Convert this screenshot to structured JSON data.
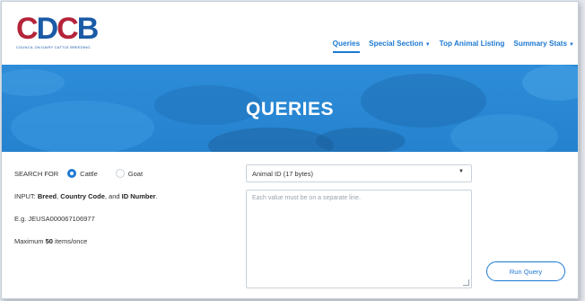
{
  "logo": {
    "mark_c1": "C",
    "mark_d": "D",
    "mark_c2": "C",
    "mark_b": "B",
    "subtitle": "COUNCIL ON DAIRY CATTLE BREEDING"
  },
  "nav": {
    "items": [
      {
        "label": "Queries",
        "active": true,
        "dropdown": false
      },
      {
        "label": "Special Section",
        "active": false,
        "dropdown": true
      },
      {
        "label": "Top Animal Listing",
        "active": false,
        "dropdown": false
      },
      {
        "label": "Summary Stats",
        "active": false,
        "dropdown": true
      }
    ],
    "accent_color": "#1d79d3"
  },
  "banner": {
    "title": "QUERIES",
    "color": "#2582cf"
  },
  "search": {
    "label": "SEARCH FOR",
    "options": [
      {
        "label": "Cattle",
        "checked": true
      },
      {
        "label": "Goat",
        "checked": false
      }
    ]
  },
  "instructions": {
    "input_prefix": "INPUT: ",
    "input_breed": "Breed",
    "input_sep1": ", ",
    "input_country": "Country Code",
    "input_sep2": ", and ",
    "input_id": "ID Number",
    "input_end": ".",
    "example": "E.g. JEUSA000067106977",
    "max_prefix": "Maximum ",
    "max_value": "50",
    "max_suffix": " items/once"
  },
  "id_select": {
    "value": "Animal ID (17 bytes)"
  },
  "values_input": {
    "placeholder": "Each value must be on a separate line."
  },
  "run_button": {
    "label": "Run Query"
  }
}
